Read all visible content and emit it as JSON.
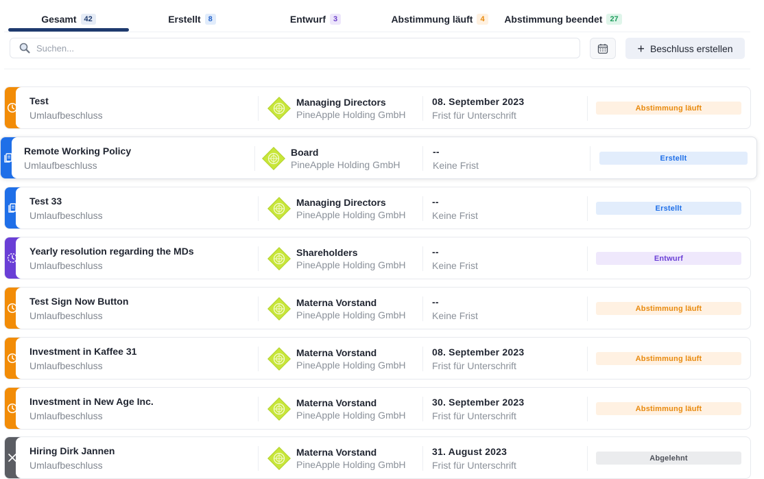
{
  "tabs": [
    {
      "label": "Gesamt",
      "count": "42",
      "badge_bg": "#e6ecf6",
      "badge_color": "#1e3a6e"
    },
    {
      "label": "Erstellt",
      "count": "8",
      "badge_bg": "#e1ecfb",
      "badge_color": "#2563c9"
    },
    {
      "label": "Entwurf",
      "count": "3",
      "badge_bg": "#ede6fb",
      "badge_color": "#6b3fc8"
    },
    {
      "label": "Abstimmung läuft",
      "count": "4",
      "badge_bg": "#fff1e0",
      "badge_color": "#e8890c"
    },
    {
      "label": "Abstimmung beendet",
      "count": "27",
      "badge_bg": "#dff5ea",
      "badge_color": "#1f9d5c"
    }
  ],
  "active_tab": "Gesamt",
  "search": {
    "placeholder": "Suchen...",
    "value": ""
  },
  "toolbar": {
    "create_label": "Beschluss erstellen"
  },
  "colors": {
    "accent": "#1e3a6e",
    "voting": "#f28c07",
    "created": "#1f6fe8",
    "draft": "#6a3fd6",
    "rejected": "#5b5d63"
  },
  "rows": [
    {
      "title": "Test",
      "type": "Umlaufbeschluss",
      "board": "Managing Directors",
      "company": "PineApple Holding GmbH",
      "date": "08. September 2023",
      "deadline": "Frist für Unterschrift",
      "status": "Abstimmung läuft",
      "status_kind": "voting",
      "icon": "clock-icon"
    },
    {
      "title": "Remote Working Policy",
      "type": "Umlaufbeschluss",
      "board": "Board",
      "company": "PineApple Holding GmbH",
      "date": "--",
      "deadline": "Keine Frist",
      "status": "Erstellt",
      "status_kind": "created",
      "icon": "document-copy-icon"
    },
    {
      "title": "Test 33",
      "type": "Umlaufbeschluss",
      "board": "Managing Directors",
      "company": "PineApple Holding GmbH",
      "date": "--",
      "deadline": "Keine Frist",
      "status": "Erstellt",
      "status_kind": "created",
      "icon": "document-copy-icon"
    },
    {
      "title": "Yearly resolution regarding the MDs",
      "type": "Umlaufbeschluss",
      "board": "Shareholders",
      "company": "PineApple Holding GmbH",
      "date": "--",
      "deadline": "Keine Frist",
      "status": "Entwurf",
      "status_kind": "draft",
      "icon": "dashed-clock-icon"
    },
    {
      "title": "Test Sign Now Button",
      "type": "Umlaufbeschluss",
      "board": "Materna Vorstand",
      "company": "PineApple Holding GmbH",
      "date": "--",
      "deadline": "Keine Frist",
      "status": "Abstimmung läuft",
      "status_kind": "voting",
      "icon": "clock-icon"
    },
    {
      "title": "Investment in Kaffee 31",
      "type": "Umlaufbeschluss",
      "board": "Materna Vorstand",
      "company": "PineApple Holding GmbH",
      "date": "08. September 2023",
      "deadline": "Frist für Unterschrift",
      "status": "Abstimmung läuft",
      "status_kind": "voting",
      "icon": "clock-icon"
    },
    {
      "title": "Investment in New Age Inc.",
      "type": "Umlaufbeschluss",
      "board": "Materna Vorstand",
      "company": "PineApple Holding GmbH",
      "date": "30. September 2023",
      "deadline": "Frist für Unterschrift",
      "status": "Abstimmung läuft",
      "status_kind": "voting",
      "icon": "clock-icon"
    },
    {
      "title": "Hiring Dirk Jannen",
      "type": "Umlaufbeschluss",
      "board": "Materna Vorstand",
      "company": "PineApple Holding GmbH",
      "date": "31. August 2023",
      "deadline": "Frist für Unterschrift",
      "status": "Abgelehnt",
      "status_kind": "rejected",
      "icon": "close-icon"
    }
  ]
}
